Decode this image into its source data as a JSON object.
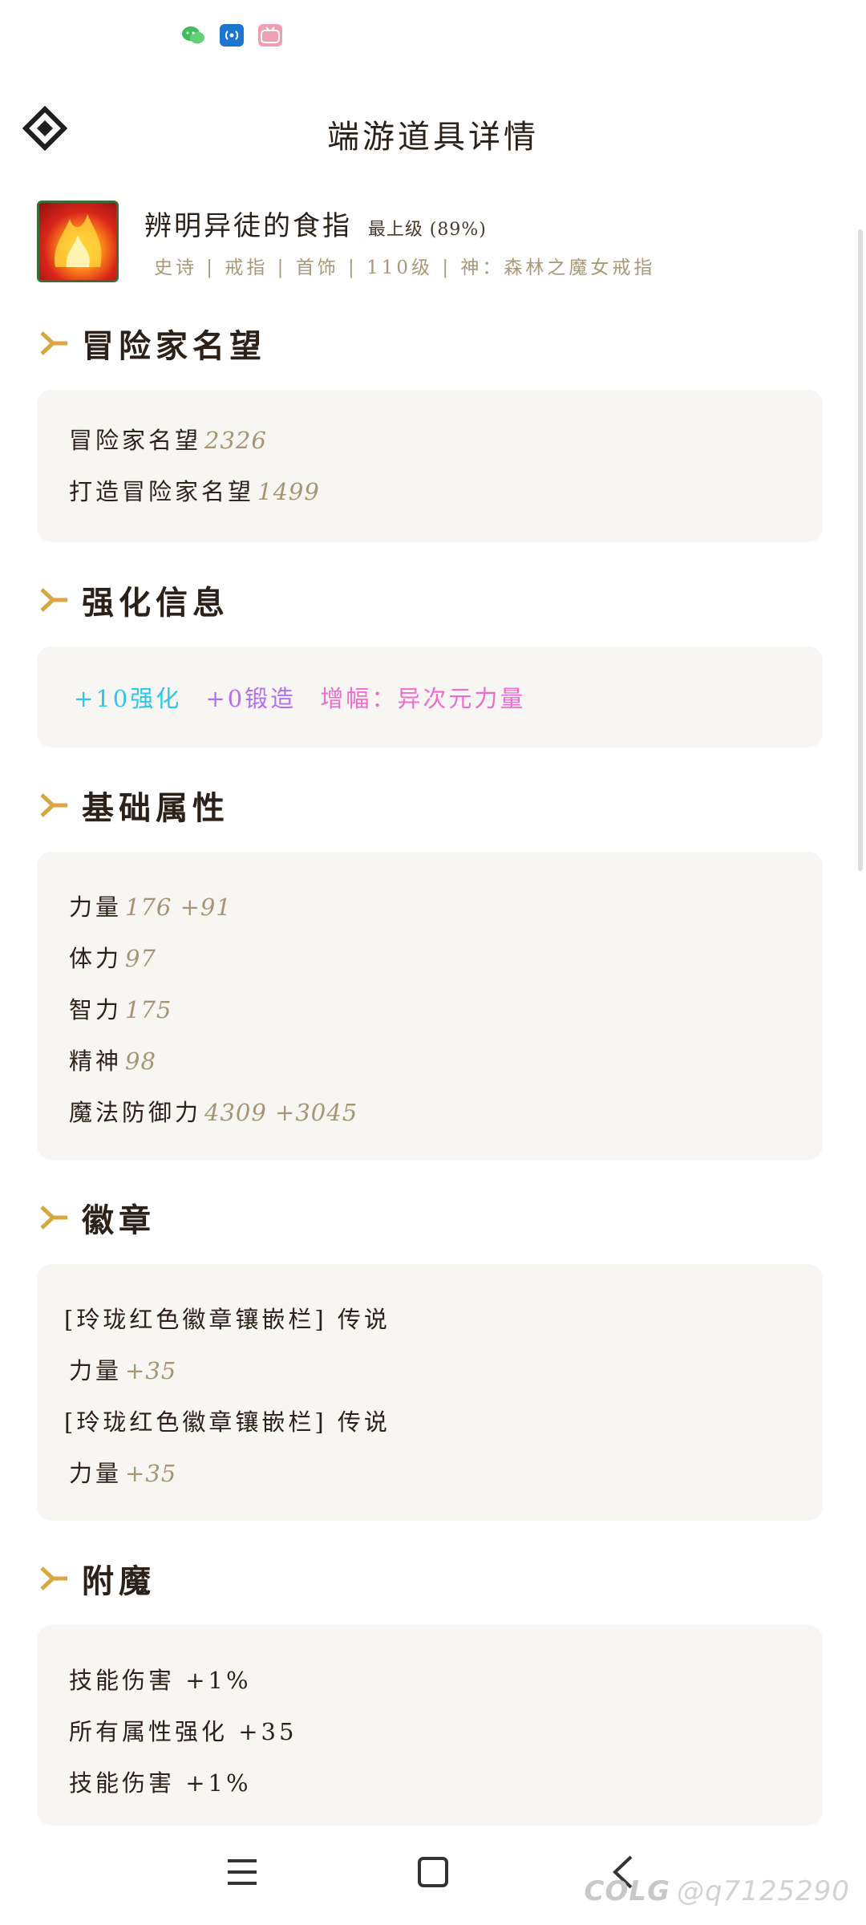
{
  "status_bar": {
    "icons": [
      "wechat-icon",
      "cast-icon",
      "bilibili-icon"
    ]
  },
  "header": {
    "title": "端游道具详情",
    "logo_icon": "diamond-logo-icon"
  },
  "item": {
    "name": "辨明异徒的食指",
    "grade": "最上级 (89%)",
    "meta": "史诗 | 戒指 | 首饰 | 110级 | 神：森林之魔女戒指"
  },
  "sections": {
    "fame": {
      "title": "冒险家名望",
      "rows": [
        {
          "label": "冒险家名望",
          "value": "2326"
        },
        {
          "label": "打造冒险家名望",
          "value": "1499"
        }
      ]
    },
    "enhance": {
      "title": "强化信息",
      "plus": "+10强化",
      "forge": "+0锻造",
      "amp": "增幅：异次元力量"
    },
    "base": {
      "title": "基础属性",
      "rows": [
        {
          "label": "力量",
          "value": "176 +91"
        },
        {
          "label": "体力",
          "value": "97"
        },
        {
          "label": "智力",
          "value": "175"
        },
        {
          "label": "精神",
          "value": "98"
        },
        {
          "label": "魔法防御力",
          "value": "4309 +3045"
        }
      ]
    },
    "emblem": {
      "title": "徽章",
      "rows": [
        {
          "label": "[玲珑红色徽章镶嵌栏] 传说",
          "value": ""
        },
        {
          "label": "力量",
          "value": "+35"
        },
        {
          "label": "[玲珑红色徽章镶嵌栏] 传说",
          "value": ""
        },
        {
          "label": "力量",
          "value": "+35"
        }
      ]
    },
    "enchant": {
      "title": "附魔",
      "rows": [
        {
          "label": "技能伤害 +1%"
        },
        {
          "label": "所有属性强化 +35"
        },
        {
          "label": "技能伤害 +1%"
        }
      ]
    }
  },
  "navbar": {
    "buttons": [
      "menu-icon",
      "home-icon",
      "back-icon"
    ]
  },
  "watermark": {
    "brand": "COLG",
    "user": "@q7125290"
  },
  "colors": {
    "accent": "#d9a73f",
    "value": "#a49675",
    "card": "#f8f6f3"
  }
}
